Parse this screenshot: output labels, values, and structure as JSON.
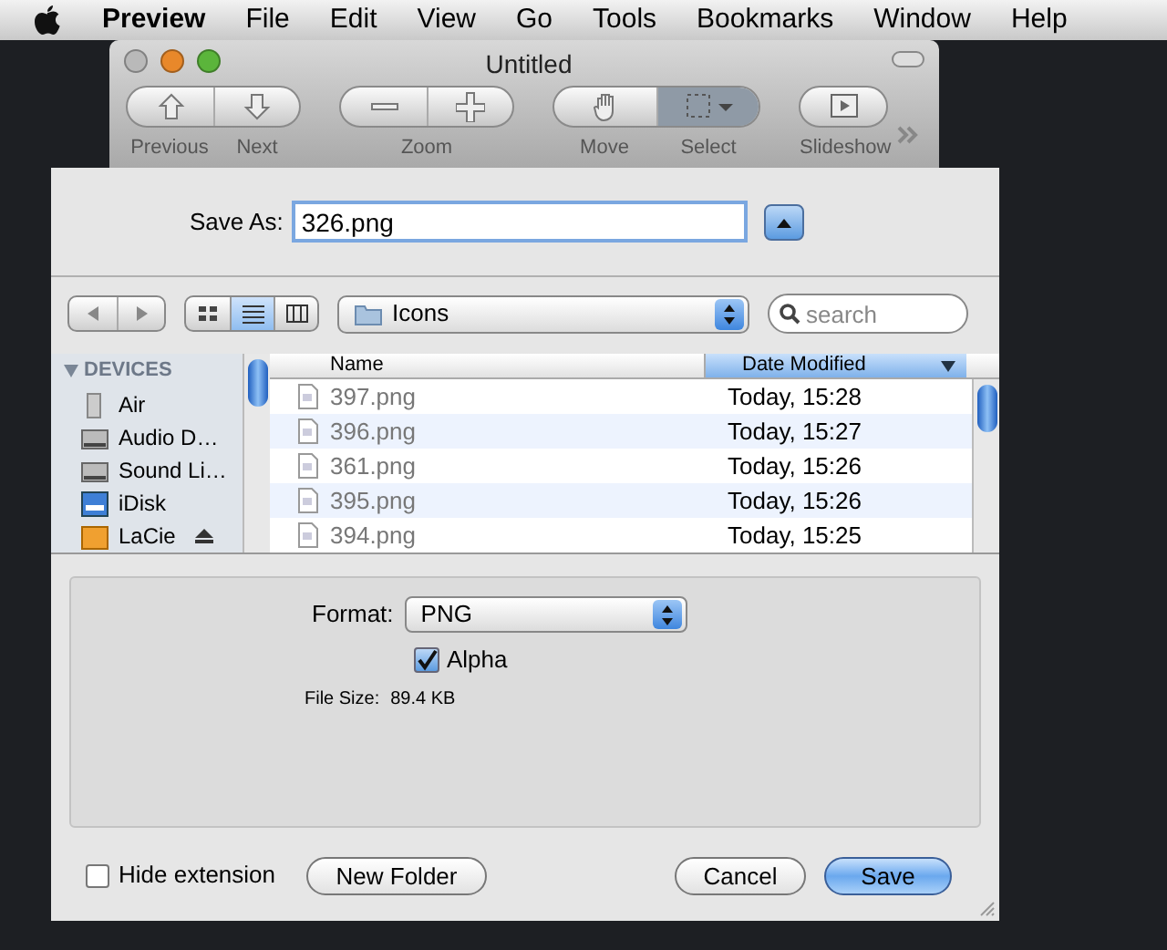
{
  "menubar": {
    "app_name": "Preview",
    "items": [
      "File",
      "Edit",
      "View",
      "Go",
      "Tools",
      "Bookmarks",
      "Window",
      "Help"
    ]
  },
  "preview_window": {
    "title": "Untitled",
    "toolbar": [
      {
        "kind": "nav",
        "segments": [
          {
            "label": "Previous"
          },
          {
            "label": "Next"
          }
        ]
      },
      {
        "kind": "zoom",
        "label": "Zoom"
      },
      {
        "kind": "tools",
        "segments": [
          {
            "label": "Move",
            "selected": false
          },
          {
            "label": "Select",
            "selected": true
          }
        ]
      },
      {
        "kind": "slideshow",
        "segments": [
          {
            "label": "Slideshow"
          }
        ]
      }
    ]
  },
  "save_dialog": {
    "save_as_label": "Save As:",
    "filename": "326.png",
    "expanded": true,
    "view_buttons": [
      {
        "kind": "icons",
        "selected": false
      },
      {
        "kind": "list",
        "selected": true
      },
      {
        "kind": "columns",
        "selected": false
      }
    ],
    "location": "Icons",
    "search": {
      "placeholder": "search"
    },
    "sidebar": {
      "section": "DEVICES",
      "expanded": true,
      "items": [
        {
          "kind": "ipod",
          "label": "Air"
        },
        {
          "kind": "drive",
          "label": "Audio D…"
        },
        {
          "kind": "drive",
          "label": "Sound Li…"
        },
        {
          "kind": "idisk",
          "label": "iDisk"
        },
        {
          "kind": "lacie",
          "label": "LaCie"
        }
      ]
    },
    "table": {
      "columns": [
        {
          "label": "Name",
          "sorted": false
        },
        {
          "label": "Date Modified",
          "sorted": true
        }
      ],
      "rows": [
        {
          "name": "397.png",
          "date": "Today, 15:28"
        },
        {
          "name": "396.png",
          "date": "Today, 15:27"
        },
        {
          "name": "361.png",
          "date": "Today, 15:26"
        },
        {
          "name": "395.png",
          "date": "Today, 15:26"
        },
        {
          "name": "394.png",
          "date": "Today, 15:25"
        }
      ]
    },
    "options": {
      "format_label": "Format:",
      "format": "PNG",
      "alpha": {
        "label": "Alpha",
        "checked": true
      },
      "file_size_label": "File Size:",
      "file_size": "89.4 KB"
    },
    "hide_extension": {
      "label": "Hide extension",
      "checked": false
    },
    "buttons": [
      {
        "kind": "normal",
        "label": "New Folder"
      },
      {
        "kind": "spacer_before",
        "label": "Cancel"
      },
      {
        "kind": "default",
        "label": "Save"
      }
    ]
  }
}
